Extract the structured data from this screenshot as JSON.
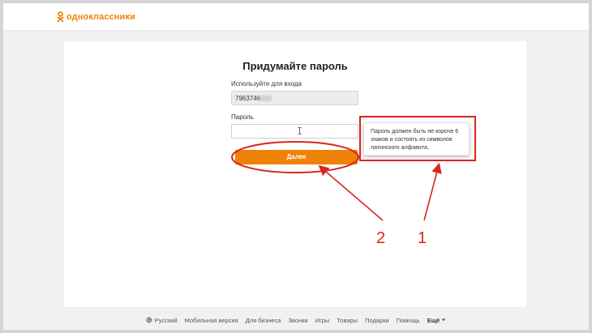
{
  "header": {
    "logo_text": "одноклассники",
    "brand_color": "#ee8208"
  },
  "form": {
    "title": "Придумайте пароль",
    "login_label": "Используйте для входа",
    "login_value": "7963746",
    "password_label": "Пароль",
    "password_value": "",
    "next_button_label": "Далее"
  },
  "tooltip": {
    "text": "Пароль должен быть не короче 6 знаков и состоять из символов латинского алфавита."
  },
  "footer": {
    "language": "Русский",
    "links": [
      "Мобильная версия",
      "Для бизнеса",
      "Звонки",
      "Игры",
      "Товары",
      "Подарки",
      "Помощь"
    ],
    "more_label": "Ещё"
  },
  "annotations": {
    "labels": [
      "1",
      "2"
    ],
    "color": "#d9251c"
  }
}
